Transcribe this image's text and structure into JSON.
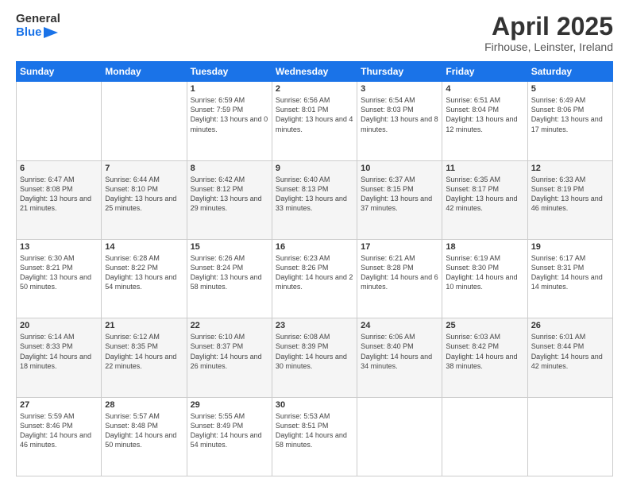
{
  "header": {
    "logo_line1": "General",
    "logo_line2": "Blue",
    "month_title": "April 2025",
    "location": "Firhouse, Leinster, Ireland"
  },
  "days_of_week": [
    "Sunday",
    "Monday",
    "Tuesday",
    "Wednesday",
    "Thursday",
    "Friday",
    "Saturday"
  ],
  "weeks": [
    [
      {
        "day": "",
        "text": ""
      },
      {
        "day": "",
        "text": ""
      },
      {
        "day": "1",
        "text": "Sunrise: 6:59 AM\nSunset: 7:59 PM\nDaylight: 13 hours and 0 minutes."
      },
      {
        "day": "2",
        "text": "Sunrise: 6:56 AM\nSunset: 8:01 PM\nDaylight: 13 hours and 4 minutes."
      },
      {
        "day": "3",
        "text": "Sunrise: 6:54 AM\nSunset: 8:03 PM\nDaylight: 13 hours and 8 minutes."
      },
      {
        "day": "4",
        "text": "Sunrise: 6:51 AM\nSunset: 8:04 PM\nDaylight: 13 hours and 12 minutes."
      },
      {
        "day": "5",
        "text": "Sunrise: 6:49 AM\nSunset: 8:06 PM\nDaylight: 13 hours and 17 minutes."
      }
    ],
    [
      {
        "day": "6",
        "text": "Sunrise: 6:47 AM\nSunset: 8:08 PM\nDaylight: 13 hours and 21 minutes."
      },
      {
        "day": "7",
        "text": "Sunrise: 6:44 AM\nSunset: 8:10 PM\nDaylight: 13 hours and 25 minutes."
      },
      {
        "day": "8",
        "text": "Sunrise: 6:42 AM\nSunset: 8:12 PM\nDaylight: 13 hours and 29 minutes."
      },
      {
        "day": "9",
        "text": "Sunrise: 6:40 AM\nSunset: 8:13 PM\nDaylight: 13 hours and 33 minutes."
      },
      {
        "day": "10",
        "text": "Sunrise: 6:37 AM\nSunset: 8:15 PM\nDaylight: 13 hours and 37 minutes."
      },
      {
        "day": "11",
        "text": "Sunrise: 6:35 AM\nSunset: 8:17 PM\nDaylight: 13 hours and 42 minutes."
      },
      {
        "day": "12",
        "text": "Sunrise: 6:33 AM\nSunset: 8:19 PM\nDaylight: 13 hours and 46 minutes."
      }
    ],
    [
      {
        "day": "13",
        "text": "Sunrise: 6:30 AM\nSunset: 8:21 PM\nDaylight: 13 hours and 50 minutes."
      },
      {
        "day": "14",
        "text": "Sunrise: 6:28 AM\nSunset: 8:22 PM\nDaylight: 13 hours and 54 minutes."
      },
      {
        "day": "15",
        "text": "Sunrise: 6:26 AM\nSunset: 8:24 PM\nDaylight: 13 hours and 58 minutes."
      },
      {
        "day": "16",
        "text": "Sunrise: 6:23 AM\nSunset: 8:26 PM\nDaylight: 14 hours and 2 minutes."
      },
      {
        "day": "17",
        "text": "Sunrise: 6:21 AM\nSunset: 8:28 PM\nDaylight: 14 hours and 6 minutes."
      },
      {
        "day": "18",
        "text": "Sunrise: 6:19 AM\nSunset: 8:30 PM\nDaylight: 14 hours and 10 minutes."
      },
      {
        "day": "19",
        "text": "Sunrise: 6:17 AM\nSunset: 8:31 PM\nDaylight: 14 hours and 14 minutes."
      }
    ],
    [
      {
        "day": "20",
        "text": "Sunrise: 6:14 AM\nSunset: 8:33 PM\nDaylight: 14 hours and 18 minutes."
      },
      {
        "day": "21",
        "text": "Sunrise: 6:12 AM\nSunset: 8:35 PM\nDaylight: 14 hours and 22 minutes."
      },
      {
        "day": "22",
        "text": "Sunrise: 6:10 AM\nSunset: 8:37 PM\nDaylight: 14 hours and 26 minutes."
      },
      {
        "day": "23",
        "text": "Sunrise: 6:08 AM\nSunset: 8:39 PM\nDaylight: 14 hours and 30 minutes."
      },
      {
        "day": "24",
        "text": "Sunrise: 6:06 AM\nSunset: 8:40 PM\nDaylight: 14 hours and 34 minutes."
      },
      {
        "day": "25",
        "text": "Sunrise: 6:03 AM\nSunset: 8:42 PM\nDaylight: 14 hours and 38 minutes."
      },
      {
        "day": "26",
        "text": "Sunrise: 6:01 AM\nSunset: 8:44 PM\nDaylight: 14 hours and 42 minutes."
      }
    ],
    [
      {
        "day": "27",
        "text": "Sunrise: 5:59 AM\nSunset: 8:46 PM\nDaylight: 14 hours and 46 minutes."
      },
      {
        "day": "28",
        "text": "Sunrise: 5:57 AM\nSunset: 8:48 PM\nDaylight: 14 hours and 50 minutes."
      },
      {
        "day": "29",
        "text": "Sunrise: 5:55 AM\nSunset: 8:49 PM\nDaylight: 14 hours and 54 minutes."
      },
      {
        "day": "30",
        "text": "Sunrise: 5:53 AM\nSunset: 8:51 PM\nDaylight: 14 hours and 58 minutes."
      },
      {
        "day": "",
        "text": ""
      },
      {
        "day": "",
        "text": ""
      },
      {
        "day": "",
        "text": ""
      }
    ]
  ]
}
